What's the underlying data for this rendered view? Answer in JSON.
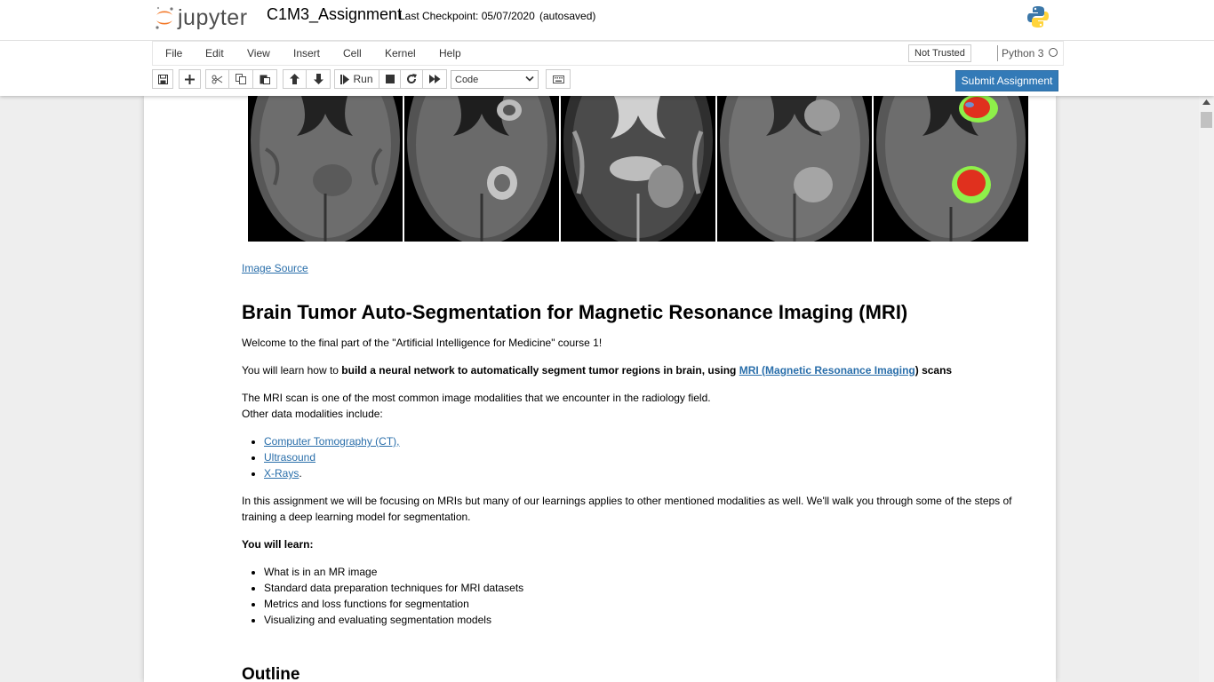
{
  "header": {
    "logo_text": "jupyter",
    "notebook_name": "C1M3_Assignment",
    "checkpoint": "Last Checkpoint: 05/07/2020",
    "autosave": "(autosaved)"
  },
  "menubar": {
    "items": [
      "File",
      "Edit",
      "View",
      "Insert",
      "Cell",
      "Kernel",
      "Help"
    ],
    "trust_label": "Not Trusted",
    "kernel_name": "Python 3"
  },
  "toolbar": {
    "buttons": [
      "save-icon",
      "plus-icon",
      "scissors-icon",
      "copy-icon",
      "paste-icon",
      "arrow-up-icon",
      "arrow-down-icon",
      "run-icon",
      "stop-icon",
      "restart-icon",
      "fast-forward-icon",
      "keyboard-icon"
    ],
    "run_label": "Run",
    "cell_type": "Code",
    "submit_label": "Submit Assignment"
  },
  "cell": {
    "image_link": "Image Source",
    "heading": "Brain Tumor Auto-Segmentation for Magnetic Resonance Imaging (MRI)",
    "intro": "Welcome to the final part of the \"Artificial Intelligence for Medicine\" course 1!",
    "learn_prefix": "You will learn how to ",
    "learn_bold": "build a neural network to automatically segment tumor regions in brain, using ",
    "mri_link": "MRI (Magnetic Resonance Imaging",
    "learn_suffix": ") scans",
    "mri_desc_1": "The MRI scan is one of the most common image modalities that we encounter in the radiology field.",
    "mri_desc_2": "Other data modalities include:",
    "modalities": [
      {
        "link": "Computer Tomography (CT)",
        "suffix": ","
      },
      {
        "link": "Ultrasound",
        "suffix": ""
      },
      {
        "link": "X-Rays",
        "suffix": "."
      }
    ],
    "focus": "In this assignment we will be focusing on MRIs but many of our learnings applies to other mentioned modalities as well. We'll walk you through some of the steps of training a deep learning model for segmentation.",
    "will_learn": "You will learn:",
    "learn_items": [
      "What is in an MR image",
      "Standard data preparation techniques for MRI datasets",
      "Metrics and loss functions for segmentation",
      "Visualizing and evaluating segmentation models"
    ],
    "outline_heading": "Outline"
  },
  "colors": {
    "accent": "#337ab7",
    "link": "#296eaa",
    "tumor_red": "#e0301e",
    "tumor_green": "#8ef04a"
  }
}
